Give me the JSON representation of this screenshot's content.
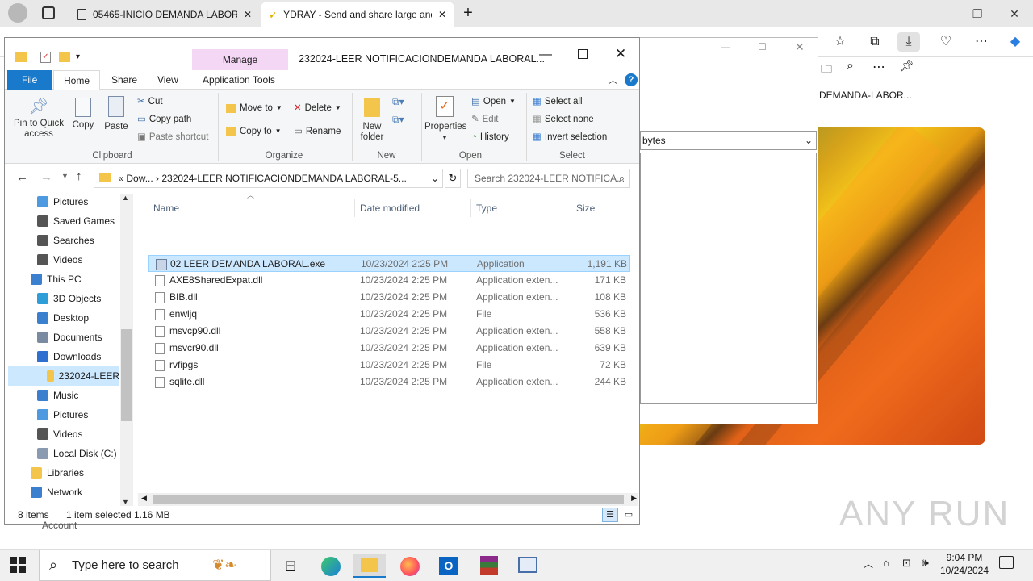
{
  "browser": {
    "tabs": [
      {
        "title": "05465-INICIO DEMANDA LABORAL",
        "icon": "document-icon"
      },
      {
        "title": "YDRAY - Send and share large and",
        "icon": "ydray-icon"
      }
    ],
    "new_tab": "+",
    "window_controls": {
      "minimize": "—",
      "restore": "❐",
      "close": "✕"
    },
    "side_title": "DEMANDA-LABOR...",
    "dialog_field": "bytes",
    "watermark": "ANY RUN"
  },
  "explorer": {
    "title": "232024-LEER NOTIFICACIONDEMANDA LABORAL...",
    "contextual_tab": "Manage",
    "ribbon_tabs": [
      "File",
      "Home",
      "Share",
      "View",
      "Application Tools"
    ],
    "clipboard": {
      "pin": "Pin to Quick access",
      "copy": "Copy",
      "paste": "Paste",
      "cut": "Cut",
      "copy_path": "Copy path",
      "paste_shortcut": "Paste shortcut",
      "label": "Clipboard"
    },
    "organize": {
      "move_to": "Move to",
      "copy_to": "Copy to",
      "delete": "Delete",
      "rename": "Rename",
      "label": "Organize"
    },
    "new": {
      "new_folder": "New folder",
      "label": "New"
    },
    "open": {
      "properties": "Properties",
      "open": "Open",
      "edit": "Edit",
      "history": "History",
      "label": "Open"
    },
    "select": {
      "select_all": "Select all",
      "select_none": "Select none",
      "invert": "Invert selection",
      "label": "Select"
    },
    "path": "«  Dow...  ›  232024-LEER NOTIFICACIONDEMANDA LABORAL-5...",
    "search_placeholder": "Search 232024-LEER NOTIFICA...",
    "nav": [
      {
        "label": "Pictures",
        "icon": "pictures-icon"
      },
      {
        "label": "Saved Games",
        "icon": "saved-games-icon"
      },
      {
        "label": "Searches",
        "icon": "search-icon"
      },
      {
        "label": "Videos",
        "icon": "videos-icon"
      },
      {
        "label": "This PC",
        "icon": "computer-icon"
      },
      {
        "label": "3D Objects",
        "icon": "3d-objects-icon"
      },
      {
        "label": "Desktop",
        "icon": "desktop-icon"
      },
      {
        "label": "Documents",
        "icon": "documents-icon"
      },
      {
        "label": "Downloads",
        "icon": "downloads-icon"
      },
      {
        "label": "232024-LEER",
        "icon": "folder-icon"
      },
      {
        "label": "Music",
        "icon": "music-icon"
      },
      {
        "label": "Pictures",
        "icon": "pictures-icon"
      },
      {
        "label": "Videos",
        "icon": "videos-icon"
      },
      {
        "label": "Local Disk (C:)",
        "icon": "drive-icon"
      },
      {
        "label": "Libraries",
        "icon": "libraries-icon"
      },
      {
        "label": "Network",
        "icon": "network-icon"
      }
    ],
    "columns": {
      "name": "Name",
      "date": "Date modified",
      "type": "Type",
      "size": "Size"
    },
    "files": [
      {
        "name": "02 LEER DEMANDA LABORAL.exe",
        "date": "10/23/2024 2:25 PM",
        "type": "Application",
        "size": "1,191 KB"
      },
      {
        "name": "AXE8SharedExpat.dll",
        "date": "10/23/2024 2:25 PM",
        "type": "Application exten...",
        "size": "171 KB"
      },
      {
        "name": "BIB.dll",
        "date": "10/23/2024 2:25 PM",
        "type": "Application exten...",
        "size": "108 KB"
      },
      {
        "name": "enwljq",
        "date": "10/23/2024 2:25 PM",
        "type": "File",
        "size": "536 KB"
      },
      {
        "name": "msvcp90.dll",
        "date": "10/23/2024 2:25 PM",
        "type": "Application exten...",
        "size": "558 KB"
      },
      {
        "name": "msvcr90.dll",
        "date": "10/23/2024 2:25 PM",
        "type": "Application exten...",
        "size": "639 KB"
      },
      {
        "name": "rvfipgs",
        "date": "10/23/2024 2:25 PM",
        "type": "File",
        "size": "72 KB"
      },
      {
        "name": "sqlite.dll",
        "date": "10/23/2024 2:25 PM",
        "type": "Application exten...",
        "size": "244 KB"
      }
    ],
    "status": {
      "count": "8 items",
      "selected": "1 item selected",
      "size": "1.16 MB"
    },
    "behind_text": "Account"
  },
  "taskbar": {
    "search_placeholder": "Type here to search",
    "time": "9:04 PM",
    "date": "10/24/2024"
  },
  "colors": {
    "accent": "#1979ca",
    "selection": "#cce8ff",
    "manage": "#f3d7f5"
  }
}
